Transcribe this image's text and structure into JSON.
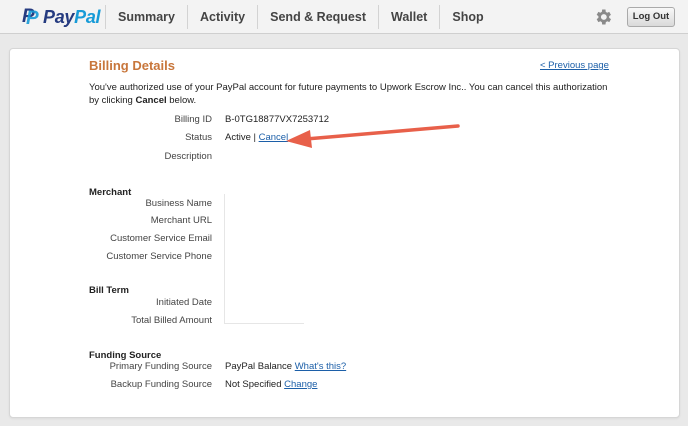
{
  "header": {
    "logo_part1": "Pay",
    "logo_part2": "Pal",
    "nav": [
      "Summary",
      "Activity",
      "Send & Request",
      "Wallet",
      "Shop"
    ],
    "logout_label": "Log Out"
  },
  "page": {
    "title": "Billing Details",
    "previous_link": "< Previous page",
    "intro_text": "You've authorized use of your PayPal account for future payments to Upwork Escrow Inc.. You can cancel this authorization by clicking ",
    "intro_bold": "Cancel",
    "intro_end": " below."
  },
  "billing": {
    "id_label": "Billing ID",
    "id_value": "B-0TG18877VX7253712",
    "status_label": "Status",
    "status_value": "Active",
    "status_sep": " | ",
    "cancel_link": "Cancel",
    "description_label": "Description"
  },
  "merchant": {
    "heading": "Merchant",
    "business_name_label": "Business Name",
    "merchant_url_label": "Merchant URL",
    "cs_email_label": "Customer Service Email",
    "cs_phone_label": "Customer Service Phone"
  },
  "bill_term": {
    "heading": "Bill Term",
    "initiated_label": "Initiated Date",
    "total_label": "Total Billed Amount"
  },
  "funding": {
    "heading": "Funding Source",
    "primary_label": "Primary Funding Source",
    "primary_value": "PayPal Balance",
    "primary_link": "What's this?",
    "backup_label": "Backup Funding Source",
    "backup_value": "Not Specified",
    "backup_link": "Change"
  },
  "colors": {
    "title": "#c8763b",
    "link": "#1c5fa8",
    "arrow": "#e8604a",
    "paypal_dark": "#253b80",
    "paypal_light": "#179bd7"
  },
  "icons": [
    "gear-icon",
    "annotation-arrow-icon"
  ]
}
